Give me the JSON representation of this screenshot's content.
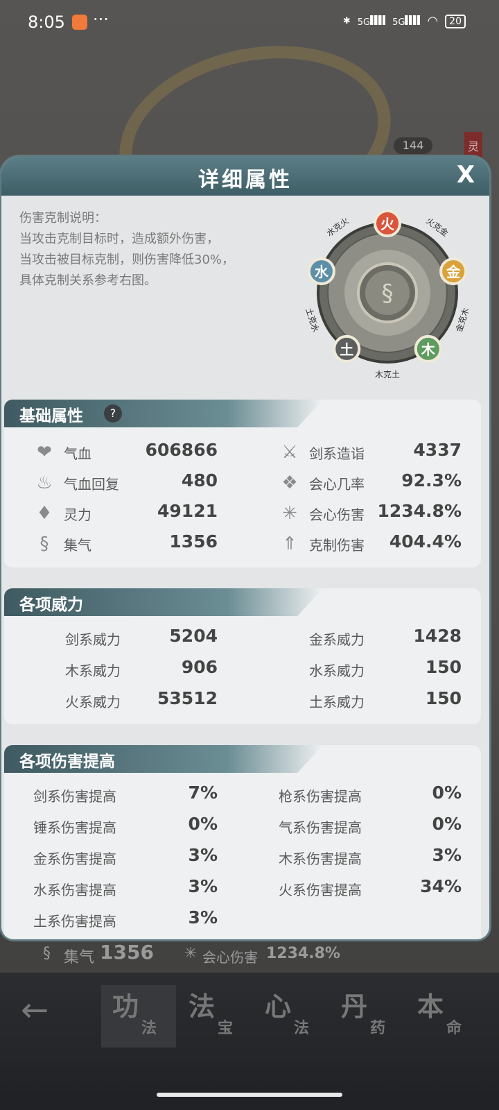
{
  "status_bar": {
    "time": "8:05",
    "dots": "···",
    "net1": "5G",
    "net2": "5G",
    "battery": "20"
  },
  "modal": {
    "title": "详细属性",
    "close": "X",
    "description": [
      "伤害克制说明：",
      "当攻击克制目标时，造成额外伤害，",
      "当攻击被目标克制，则伤害降低30%，",
      "具体克制关系参考右图。"
    ],
    "wheel": {
      "elements": [
        {
          "name": "火",
          "color": "#d9553c"
        },
        {
          "name": "金",
          "color": "#d9a23a"
        },
        {
          "name": "木",
          "color": "#5e9b5e"
        },
        {
          "name": "土",
          "color": "#5d5e5e"
        },
        {
          "name": "水",
          "color": "#5d8fa9"
        }
      ],
      "relations": [
        "火克金",
        "金克木",
        "木克土",
        "土克水",
        "水克火"
      ]
    }
  },
  "basic": {
    "title": "基础属性",
    "help": "?",
    "left": [
      {
        "label": "气血",
        "value": "606866",
        "icon": "heart-icon"
      },
      {
        "label": "气血回复",
        "value": "480",
        "icon": "heal-icon"
      },
      {
        "label": "灵力",
        "value": "49121",
        "icon": "flame-icon"
      },
      {
        "label": "集气",
        "value": "1356",
        "icon": "swirl-icon"
      }
    ],
    "right": [
      {
        "label": "剑系造诣",
        "value": "4337",
        "icon": "sword-icon"
      },
      {
        "label": "会心几率",
        "value": "92.3%",
        "icon": "crit-rate-icon"
      },
      {
        "label": "会心伤害",
        "value": "1234.8%",
        "icon": "burst-icon"
      },
      {
        "label": "克制伤害",
        "value": "404.4%",
        "icon": "counter-icon"
      }
    ]
  },
  "power": {
    "title": "各项威力",
    "left": [
      {
        "label": "剑系威力",
        "value": "5204"
      },
      {
        "label": "木系威力",
        "value": "906"
      },
      {
        "label": "火系威力",
        "value": "53512"
      }
    ],
    "right": [
      {
        "label": "金系威力",
        "value": "1428"
      },
      {
        "label": "水系威力",
        "value": "150"
      },
      {
        "label": "土系威力",
        "value": "150"
      }
    ]
  },
  "damage": {
    "title": "各项伤害提高",
    "left": [
      {
        "label": "剑系伤害提高",
        "value": "7%"
      },
      {
        "label": "锤系伤害提高",
        "value": "0%"
      },
      {
        "label": "金系伤害提高",
        "value": "3%"
      },
      {
        "label": "水系伤害提高",
        "value": "3%"
      },
      {
        "label": "土系伤害提高",
        "value": "3%"
      }
    ],
    "right": [
      {
        "label": "枪系伤害提高",
        "value": "0%"
      },
      {
        "label": "气系伤害提高",
        "value": "0%"
      },
      {
        "label": "木系伤害提高",
        "value": "3%"
      },
      {
        "label": "火系伤害提高",
        "value": "34%"
      }
    ]
  },
  "behind": {
    "badge": "144",
    "side_tag": "灵",
    "strip_label1": "集气",
    "strip_value1": "1356",
    "strip_label2": "会心伤害",
    "strip_value2": "1234.8%"
  },
  "nav": {
    "back": "←",
    "tabs": [
      {
        "c1": "功",
        "c2": "法",
        "active": true
      },
      {
        "c1": "法",
        "c2": "宝"
      },
      {
        "c1": "心",
        "c2": "法"
      },
      {
        "c1": "丹",
        "c2": "药"
      },
      {
        "c1": "本",
        "c2": "命"
      }
    ]
  },
  "colors": {
    "accent": "#4c6d75",
    "panel": "#eef0f1",
    "nav": "#2b2d30"
  }
}
